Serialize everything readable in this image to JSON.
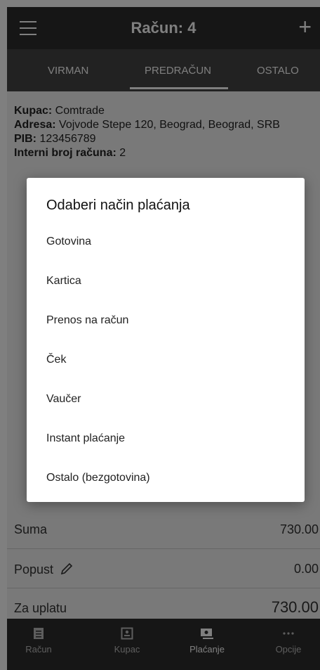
{
  "header": {
    "title": "Račun: 4",
    "menu_icon": "hamburger-icon",
    "add_icon": "plus-icon",
    "add_glyph": "+"
  },
  "tabs": [
    {
      "label": "VIRMAN"
    },
    {
      "label": "PREDRAČUN"
    },
    {
      "label": "OSTALO"
    }
  ],
  "customer": {
    "kupac_label": "Kupac:",
    "kupac_value": " Comtrade",
    "adresa_label": "Adresa:",
    "adresa_value": " Vojvode Stepe 120, Beograd, Beograd, SRB",
    "pib_label": "PIB:",
    "pib_value": " 123456789",
    "interni_label": "Interni broj računa:",
    "interni_value": " 2"
  },
  "totals": {
    "suma_label": "Suma",
    "suma_value": "730.00",
    "popust_label": "Popust",
    "popust_value": "0.00",
    "za_uplatu_label": "Za uplatu",
    "za_uplatu_value": "730.00"
  },
  "bottom_nav": [
    {
      "label": "Račun",
      "icon": "receipt-icon"
    },
    {
      "label": "Kupac",
      "icon": "contact-icon"
    },
    {
      "label": "Plaćanje",
      "icon": "payment-icon"
    },
    {
      "label": "Opcije",
      "icon": "more-icon"
    }
  ],
  "dialog": {
    "title": "Odaberi način plaćanja",
    "options": [
      "Gotovina",
      "Kartica",
      "Prenos na račun",
      "Ček",
      "Vaučer",
      "Instant plaćanje",
      "Ostalo (bezgotovina)"
    ]
  }
}
